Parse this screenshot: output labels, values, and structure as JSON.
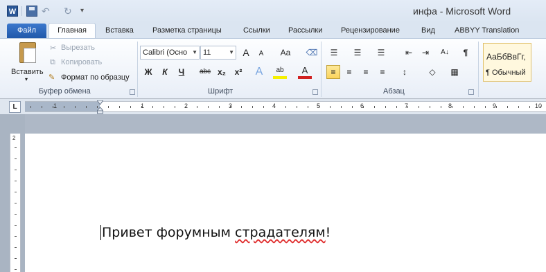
{
  "window": {
    "title": "инфа - Microsoft Word"
  },
  "qat": {
    "word_logo": "W",
    "undo_glyph": "↶",
    "redo_glyph": "↻",
    "more_glyph": "▾"
  },
  "tabs": {
    "file": "Файл",
    "items": [
      "Главная",
      "Вставка",
      "Разметка страницы",
      "Ссылки",
      "Рассылки",
      "Рецензирование",
      "Вид",
      "ABBYY Translation"
    ]
  },
  "ribbon": {
    "clipboard": {
      "paste": "Вставить",
      "paste_arrow": "▾",
      "cut": "Вырезать",
      "copy": "Копировать",
      "format_painter": "Формат по образцу",
      "group_label": "Буфер обмена"
    },
    "font": {
      "font_name": "Calibri (Осно",
      "font_size": "11",
      "grow_glyph": "A",
      "shrink_glyph": "A",
      "case_glyph": "Aa",
      "bold": "Ж",
      "italic": "К",
      "underline": "Ч",
      "strike": "abc",
      "subscript": "x₂",
      "superscript": "x²",
      "effects_glyph": "A",
      "highlight_glyph": "ab",
      "color_glyph": "A",
      "group_label": "Шрифт"
    },
    "paragraph": {
      "bullets": "☰",
      "numbering": "☰",
      "multilevel": "☰",
      "decrease_indent": "⇤",
      "increase_indent": "⇥",
      "sort": "A↓",
      "show_marks": "¶",
      "align_left": "≡",
      "center": "≡",
      "align_right": "≡",
      "justify": "≡",
      "line_spacing": "↕",
      "shading": "◇",
      "borders": "▦",
      "group_label": "Абзац"
    },
    "styles": {
      "preview_text": "АаБбВвГг,",
      "style_name": "¶ Обычный"
    },
    "accent_color": "#fbd45c"
  },
  "ruler": {
    "tab_selector_glyph": "L",
    "numbers": [
      "1",
      "1",
      "2",
      "3",
      "4",
      "5",
      "6",
      "7",
      "8",
      "9",
      "10"
    ],
    "vertical_numbers": [
      "2"
    ]
  },
  "document": {
    "text": "Привет форумным страдателям!",
    "misspelled": "страдателям"
  }
}
